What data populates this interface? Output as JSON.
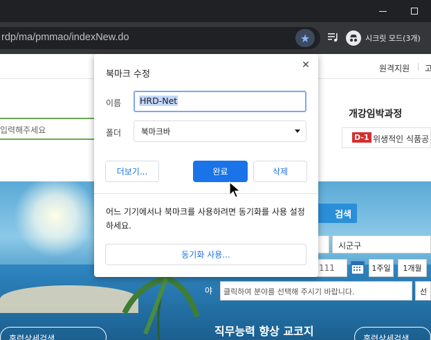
{
  "browser": {
    "url": "rdp/ma/pmmao/indexNew.do",
    "incognito_label": "시크릿 모드(3개)",
    "icons": {
      "bookmark": "star-icon",
      "media": "media-control-icon",
      "incognito": "incognito-icon",
      "minimize": "minimize-icon",
      "maximize": "maximize-icon"
    }
  },
  "page": {
    "topnav": {
      "remote_support": "원격지원",
      "next": "고"
    },
    "search_placeholder": "입력해주세요",
    "upcoming": {
      "title": "개강임박과정",
      "dday": "D-1",
      "course": "위생적인 식품공"
    },
    "search_button": "검색",
    "district_select": "시군구",
    "date_value": "111",
    "week_button": "1주일",
    "month_button": "1개월",
    "field_label": "야",
    "field_placeholder": "클릭하여 분야를 선택해 주시기 바랍니다.",
    "select_button": "선",
    "bottom_left": "훈련상세검색",
    "bottom_center": "직무능력 향상 교코지",
    "bottom_right": "훈련상세검색"
  },
  "dialog": {
    "title": "북마크 수정",
    "name_label": "이름",
    "name_value": "HRD-Net",
    "folder_label": "폴더",
    "folder_value": "북마크바",
    "more_button": "더보기...",
    "done_button": "완료",
    "delete_button": "삭제",
    "sync_message": "어느 기기에서나 북마크를 사용하려면 동기화를 사용 설정하세요.",
    "sync_button": "동기화 사용...",
    "close_icon": "close-icon"
  },
  "colors": {
    "accent": "#1a73e8",
    "titlebar": "#202124",
    "toolbar": "#35363a",
    "dday": "#d32f2f"
  }
}
